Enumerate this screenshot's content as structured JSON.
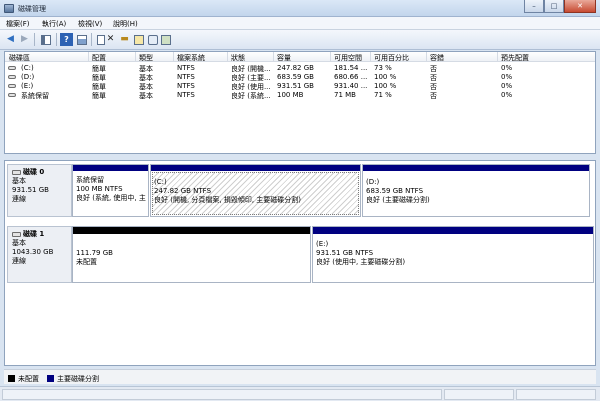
{
  "window": {
    "title": "磁碟管理",
    "buttons": [
      "–",
      "□",
      "✕"
    ]
  },
  "menu": [
    "檔案(F)",
    "執行(A)",
    "檢視(V)",
    "說明(H)"
  ],
  "columns": [
    "磁碟區",
    "配置",
    "類型",
    "檔案系統",
    "狀態",
    "容量",
    "可用空間",
    "可用百分比",
    "容錯",
    "預先配置"
  ],
  "volumes": [
    [
      "(C:)",
      "簡單",
      "基本",
      "NTFS",
      "良好 (開機...",
      "247.82 GB",
      "181.54 ...",
      "73 %",
      "否",
      "0%"
    ],
    [
      "(D:)",
      "簡單",
      "基本",
      "NTFS",
      "良好 (主要...",
      "683.59 GB",
      "680.66 ...",
      "100 %",
      "否",
      "0%"
    ],
    [
      "(E:)",
      "簡單",
      "基本",
      "NTFS",
      "良好 (使用...",
      "931.51 GB",
      "931.40 ...",
      "100 %",
      "否",
      "0%"
    ],
    [
      "系統保留",
      "簡單",
      "基本",
      "NTFS",
      "良好 (系統...",
      "100 MB",
      "71 MB",
      "71 %",
      "否",
      "0%"
    ]
  ],
  "disks": [
    {
      "name": "磁碟 0",
      "type": "基本",
      "size": "931.51 GB",
      "status": "連線",
      "partitions": [
        {
          "title": "系統保留",
          "size": "100 MB NTFS",
          "status": "良好 (系統, 使用中, 主"
        },
        {
          "title": "(C:)",
          "size": "247.82 GB NTFS",
          "status": "良好 (開機, 分頁檔案, 損毀傾印, 主要磁碟分割)"
        },
        {
          "title": "(D:)",
          "size": "683.59 GB NTFS",
          "status": "良好 (主要磁碟分割)"
        }
      ]
    },
    {
      "name": "磁碟 1",
      "type": "基本",
      "size": "1043.30 GB",
      "status": "連線",
      "partitions": [
        {
          "title": "",
          "size": "111.79 GB",
          "status": "未配置"
        },
        {
          "title": "(E:)",
          "size": "931.51 GB NTFS",
          "status": "良好 (使用中, 主要磁碟分割)"
        }
      ]
    }
  ],
  "legend": [
    {
      "label": "未配置",
      "color": "#000000"
    },
    {
      "label": "主要磁碟分割",
      "color": "#000080"
    }
  ],
  "colors": {
    "primary": "#000080",
    "unallocated": "#000000"
  }
}
